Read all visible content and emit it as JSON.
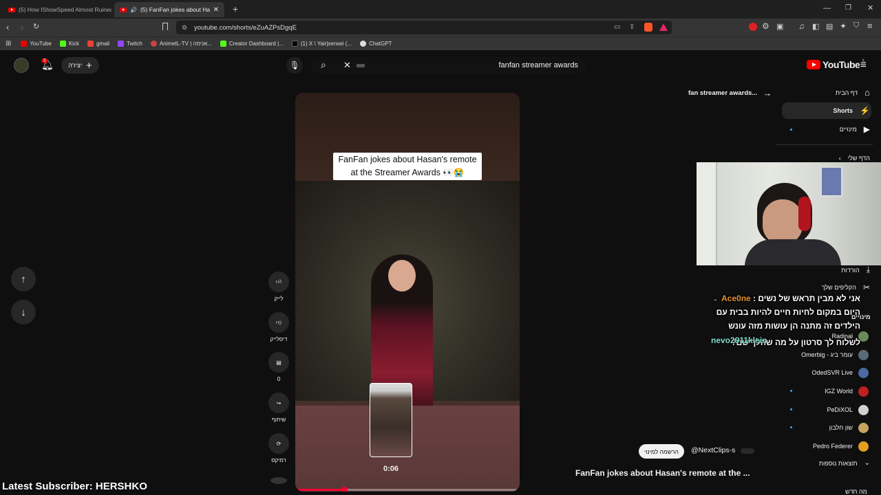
{
  "browser": {
    "tabs": [
      {
        "title": "(5) How IShowSpeed Almost Ruined",
        "active": false
      },
      {
        "title": "(5) FanFan jokes about Hasan's",
        "active": true
      }
    ],
    "new_tab_label": "+",
    "url": "youtube.com/shorts/eZuAZPsDgqE",
    "bookmarks": [
      "YouTube",
      "Kick",
      "gmail",
      "Twitch",
      "AnimeIL-TV | אנימה...",
      "Creator Dashboard |...",
      "(1) X \\ Yair|sensei (...",
      "ChatGPT"
    ]
  },
  "youtube": {
    "notif_count": "5",
    "create_label": "יצירה",
    "search_value": "fanfan streamer awards",
    "logo_text": "YouTube",
    "logo_sup": "IL"
  },
  "short": {
    "caption": "FanFan jokes about Hasan's remote at the Streamer Awards 👀😭",
    "channel": "@NextClips-s",
    "subscribe": "הרשמה למינוי",
    "title": "FanFan jokes about Hasan's remote at the ...",
    "preview_time": "0:06",
    "progress": 0.21,
    "actions": [
      {
        "label": "לייק",
        "icon": "like-icon"
      },
      {
        "label": "דיסלייק",
        "icon": "dislike-icon"
      },
      {
        "label": "0",
        "icon": "comment-icon"
      },
      {
        "label": "שיתוף",
        "icon": "share-icon"
      },
      {
        "label": "רמיקס",
        "icon": "remix-icon"
      }
    ]
  },
  "sidebar": {
    "nav": [
      "דף הבית",
      "Shorts",
      "מינויים"
    ],
    "you_label": "הדף שלי",
    "downloads": "הורדות",
    "clips": "הקליפים שלך",
    "subs_header": "מינויים",
    "subscriptions": [
      "Radinal",
      "עומר ביג - Omerbig",
      "OdedSVR Live",
      "IGZ World",
      "PeDiXOL",
      "שון חלבון",
      "Pedro Federer"
    ],
    "more": "תוצאות נוספות",
    "whats_new": "מה חדש",
    "search_back": "fan streamer awards..."
  },
  "chat": [
    {
      "user": "Ace0ne",
      "text": "אני לא מבין תראש של נשים",
      "color": "#e8902c"
    },
    {
      "user": "",
      "text": "היום במקום לחיות חיים להיות בבית עם הילדים זה מתנה הן עושות מזה עונש",
      "color": "#ffffff"
    },
    {
      "user": "nevo2911klein",
      "text": "לשלוח לך סרטון על מה שהלך שם?",
      "color": "#7fd9c8"
    }
  ],
  "overlay": {
    "latest_subscriber": "Latest Subscriber: HERSHKO"
  },
  "colors": {
    "youtube_red": "#ff0000",
    "background": "#0f0f0f"
  }
}
